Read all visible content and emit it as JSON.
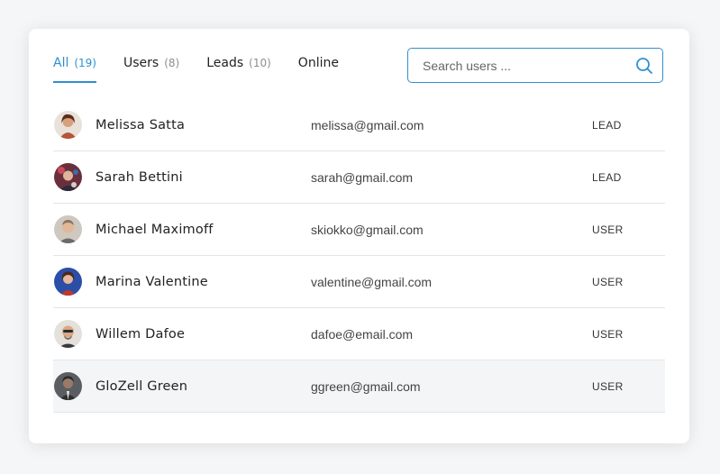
{
  "tabs": [
    {
      "label": "All",
      "count": "(19)",
      "active": true
    },
    {
      "label": "Users",
      "count": "(8)",
      "active": false
    },
    {
      "label": "Leads",
      "count": "(10)",
      "active": false
    },
    {
      "label": "Online",
      "count": "",
      "active": false
    }
  ],
  "search": {
    "placeholder": "Search users ...",
    "icon": "search-icon"
  },
  "colors": {
    "accent": "#2f8fd2",
    "row_divider": "#e3e5e8",
    "hover_row": "#f3f5f7"
  },
  "users": [
    {
      "name": "Melissa Satta",
      "email": "melissa@gmail.com",
      "role": "LEAD",
      "avatar_color": "#b5553a"
    },
    {
      "name": "Sarah Bettini",
      "email": "sarah@gmail.com",
      "role": "LEAD",
      "avatar_color": "#7a3b4a"
    },
    {
      "name": "Michael Maximoff",
      "email": "skiokko@gmail.com",
      "role": "USER",
      "avatar_color": "#b9a89a"
    },
    {
      "name": "Marina Valentine",
      "email": "valentine@gmail.com",
      "role": "USER",
      "avatar_color": "#2b4fa6"
    },
    {
      "name": "Willem Dafoe",
      "email": "dafoe@email.com",
      "role": "USER",
      "avatar_color": "#c9c3bc"
    },
    {
      "name": "GloZell Green",
      "email": "ggreen@gmail.com",
      "role": "USER",
      "avatar_color": "#5a5e63"
    }
  ]
}
